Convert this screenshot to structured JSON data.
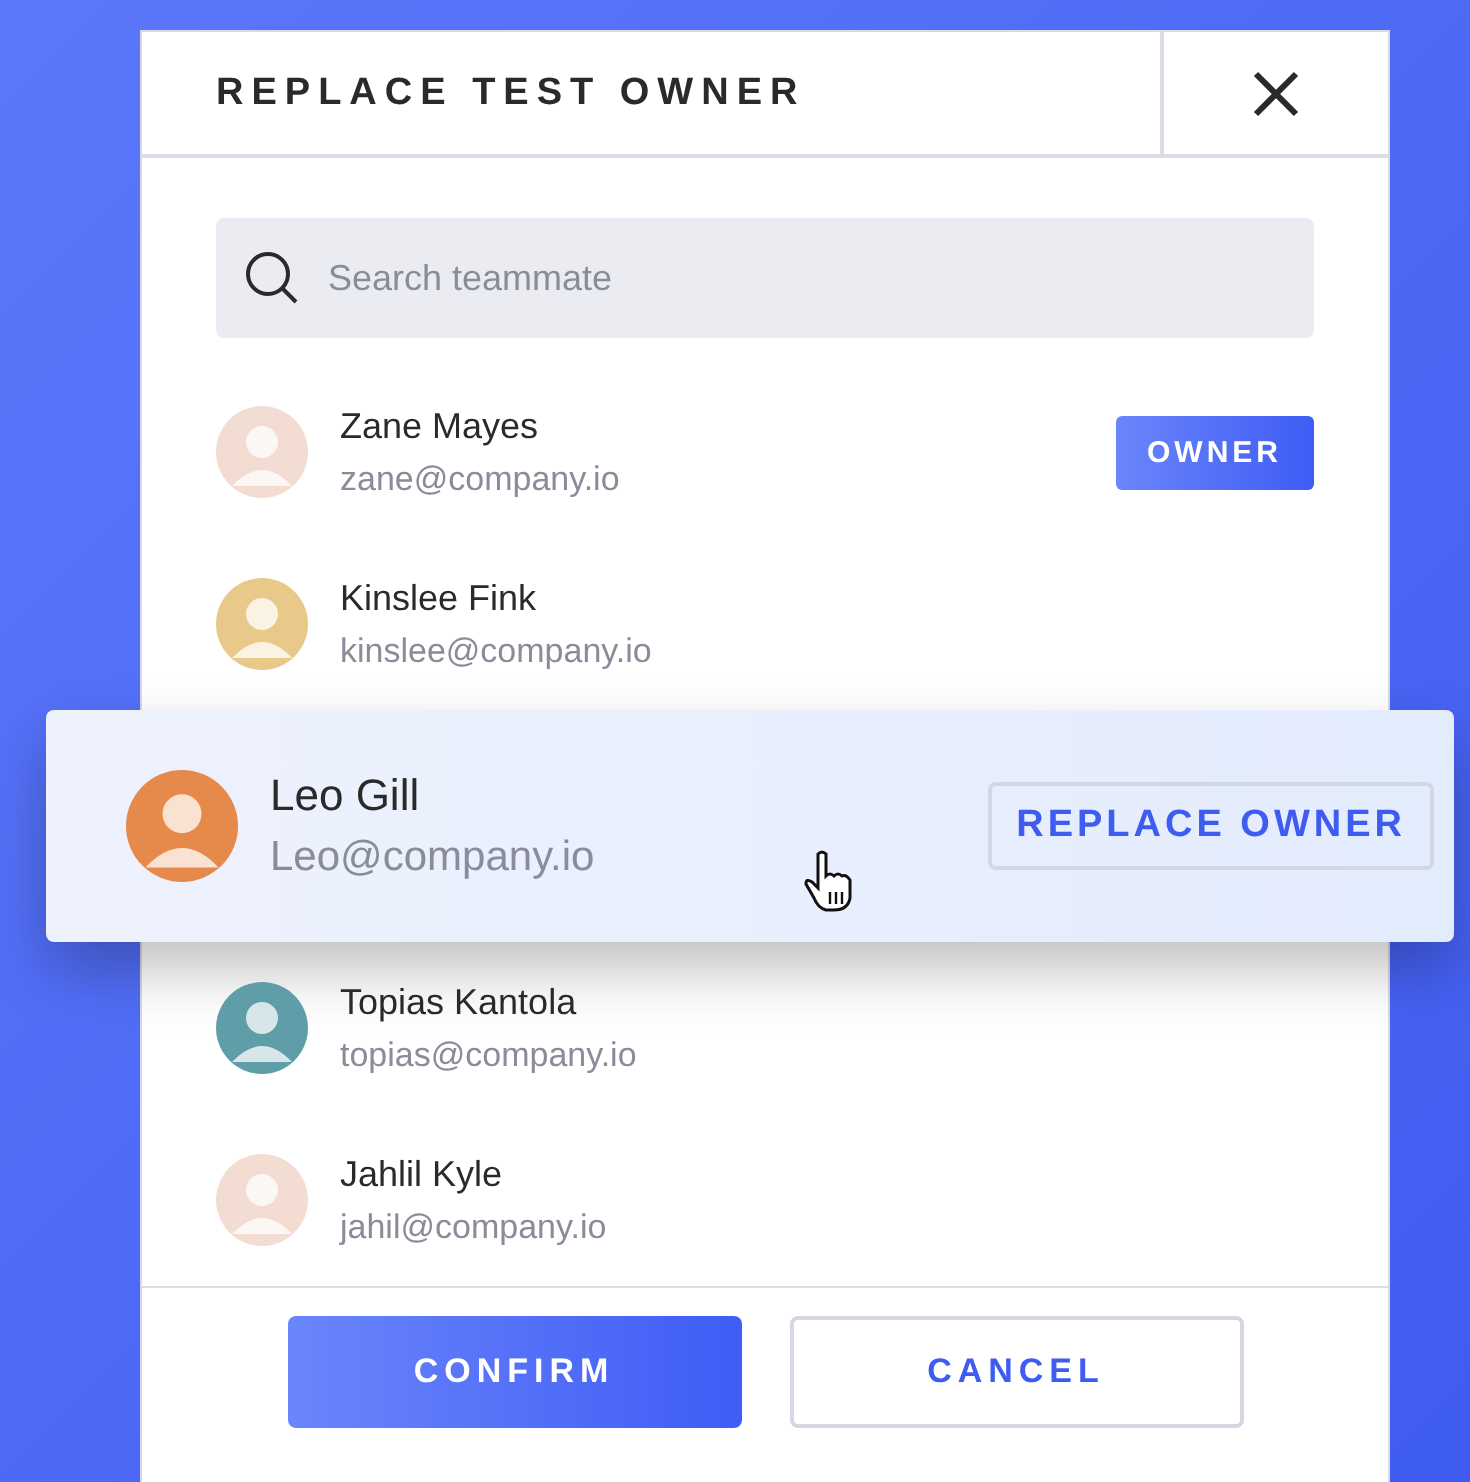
{
  "dialog": {
    "title": "REPLACE TEST OWNER"
  },
  "search": {
    "placeholder": "Search teammate"
  },
  "members": [
    {
      "name": "Zane Mayes",
      "email": "zane@company.io",
      "hovered": false,
      "badge": "OWNER"
    },
    {
      "name": "Kinslee Fink",
      "email": "kinslee@company.io",
      "hovered": false
    },
    {
      "name": "Leo Gill",
      "email": "Leo@company.io",
      "hovered": true,
      "action": "REPLACE OWNER"
    },
    {
      "name": "Topias Kantola",
      "email": "topias@company.io",
      "hovered": false
    },
    {
      "name": "Jahlil Kyle",
      "email": "jahil@company.io",
      "hovered": false
    }
  ],
  "buttons": [
    {
      "label": "CONFIRM",
      "kind": "primary"
    },
    {
      "label": "CANCEL",
      "kind": "secondary"
    }
  ]
}
